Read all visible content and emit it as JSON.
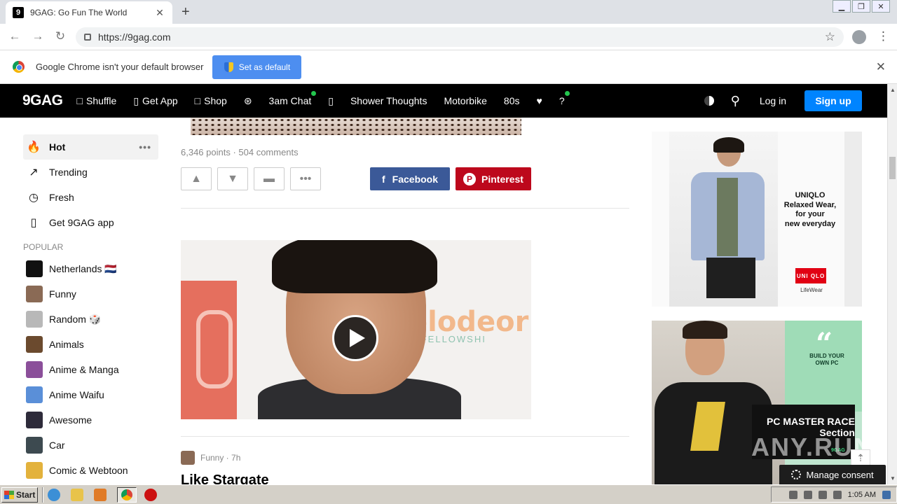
{
  "browser": {
    "tab_title": "9GAG: Go Fun The World",
    "tab_favicon": "9",
    "url": "https://9gag.com",
    "infobar_text": "Google Chrome isn't your default browser",
    "infobar_button": "Set as default"
  },
  "nav": {
    "logo": "9GAG",
    "items": [
      {
        "label": "Shuffle",
        "icon": "□"
      },
      {
        "label": "Get App",
        "icon": "▯"
      },
      {
        "label": "Shop",
        "icon": "□"
      },
      {
        "label": "",
        "icon": "⊛"
      },
      {
        "label": "3am Chat",
        "icon": "",
        "dot": true
      },
      {
        "label": "",
        "icon": "▯"
      },
      {
        "label": "Shower Thoughts",
        "icon": ""
      },
      {
        "label": "Motorbike",
        "icon": ""
      },
      {
        "label": "80s",
        "icon": ""
      },
      {
        "label": "",
        "icon": "♥"
      },
      {
        "label": "?",
        "icon": "",
        "dot": true
      }
    ],
    "login": "Log in",
    "signup": "Sign up"
  },
  "sidebar": {
    "main": [
      {
        "label": "Hot",
        "icon": "fire-icon"
      },
      {
        "label": "Trending",
        "icon": "trending-icon"
      },
      {
        "label": "Fresh",
        "icon": "clock-icon"
      },
      {
        "label": "Get 9GAG app",
        "icon": "phone-icon"
      }
    ],
    "popular_heading": "POPULAR",
    "popular": [
      {
        "label": "Netherlands 🇳🇱",
        "color": "#111111"
      },
      {
        "label": "Funny",
        "color": "#8a6a55"
      },
      {
        "label": "Random 🎲",
        "color": "#b8b8b8"
      },
      {
        "label": "Animals",
        "color": "#6b4a2e"
      },
      {
        "label": "Anime & Manga",
        "color": "#8b4f9a"
      },
      {
        "label": "Anime Waifu",
        "color": "#5a8fd8"
      },
      {
        "label": "Awesome",
        "color": "#2e2b3a"
      },
      {
        "label": "Car",
        "color": "#3d4a50"
      },
      {
        "label": "Comic & Webtoon",
        "color": "#e3b23c"
      }
    ]
  },
  "post1": {
    "meta": "6,346 points · 504 comments",
    "facebook": "Facebook",
    "pinterest": "Pinterest"
  },
  "post2": {
    "video_text_right": "elodeor",
    "video_text_sub": "G FELLOWSHI"
  },
  "post3": {
    "section": "Funny · 7h",
    "title": "Like Stargate"
  },
  "ads": {
    "uniqlo_text": "UNIQLO\nRelaxed Wear,\nfor your\nnew everyday",
    "uniqlo_logo": "UNI QLO",
    "uniqlo_sub": "LifeWear",
    "pc_quote": "“",
    "pc_build": "BUILD YOUR OWN PC",
    "pc_title": "PC MASTER RACE Section",
    "pc_sub": "9GAG"
  },
  "watermark": "ANY.RUN",
  "consent": "Manage consent",
  "taskbar": {
    "start": "Start",
    "clock": "1:05 AM"
  },
  "colors": {
    "signup": "#0084ff",
    "facebook": "#3b5998",
    "pinterest": "#bd081c",
    "infobar_button": "#4d8ef0"
  }
}
